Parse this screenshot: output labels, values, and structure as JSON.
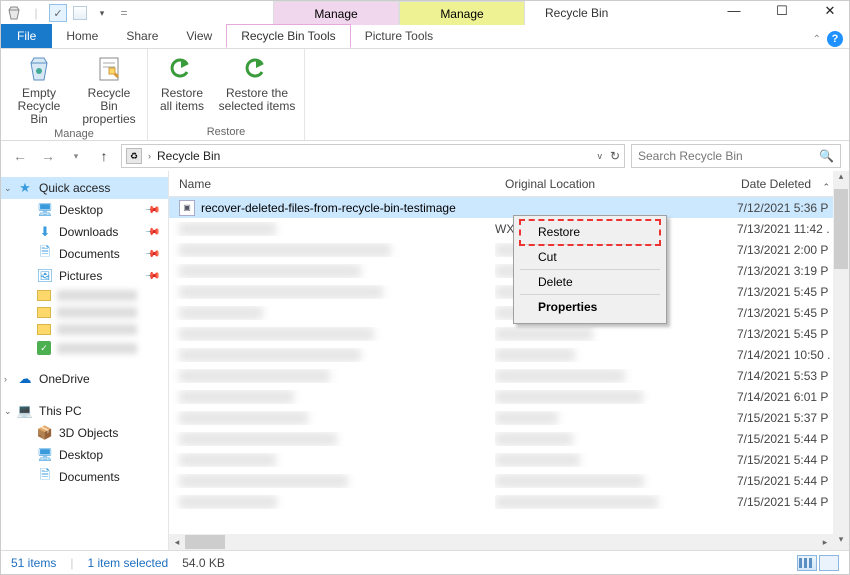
{
  "window": {
    "title": "Recycle Bin"
  },
  "qab": {
    "check": "✓"
  },
  "titleTabs": {
    "t1": {
      "manage": "Manage",
      "label": "Recycle Bin Tools"
    },
    "t2": {
      "manage": "Manage",
      "label": "Picture Tools"
    }
  },
  "tabs": {
    "file": "File",
    "home": "Home",
    "share": "Share",
    "view": "View",
    "rbt": "Recycle Bin Tools",
    "pt": "Picture Tools"
  },
  "ribbon": {
    "group1": {
      "label": "Manage",
      "btn1": "Empty\nRecycle Bin",
      "btn2": "Recycle Bin\nproperties"
    },
    "group2": {
      "label": "Restore",
      "btn1": "Restore\nall items",
      "btn2": "Restore the\nselected items"
    }
  },
  "address": {
    "text": "Recycle Bin"
  },
  "search": {
    "placeholder": "Search Recycle Bin"
  },
  "sidebar": {
    "quick": "Quick access",
    "desktop": "Desktop",
    "downloads": "Downloads",
    "documents": "Documents",
    "pictures": "Pictures",
    "onedrive": "OneDrive",
    "thispc": "This PC",
    "objects3d": "3D Objects",
    "desktop2": "Desktop",
    "documents2": "Documents"
  },
  "columns": {
    "name": "Name",
    "orig": "Original Location",
    "date": "Date Deleted"
  },
  "rows": [
    {
      "name": "recover-deleted-files-from-recycle-bin-testimage",
      "orig": "",
      "date": "7/12/2021 5:36 P"
    },
    {
      "name": "",
      "orig": "WXWork\\1...",
      "date": "7/13/2021 11:42 ."
    },
    {
      "name": "",
      "orig": "",
      "date": "7/13/2021 2:00 P"
    },
    {
      "name": "",
      "orig": "",
      "date": "7/13/2021 3:19 P"
    },
    {
      "name": "",
      "orig": "",
      "date": "7/13/2021 5:45 P"
    },
    {
      "name": "",
      "orig": "",
      "date": "7/13/2021 5:45 P"
    },
    {
      "name": "",
      "orig": "",
      "date": "7/13/2021 5:45 P"
    },
    {
      "name": "",
      "orig": "",
      "date": "7/14/2021 10:50 ."
    },
    {
      "name": "",
      "orig": "",
      "date": "7/14/2021 5:53 P"
    },
    {
      "name": "",
      "orig": "",
      "date": "7/14/2021 6:01 P"
    },
    {
      "name": "",
      "orig": "",
      "date": "7/15/2021 5:37 P"
    },
    {
      "name": "",
      "orig": "",
      "date": "7/15/2021 5:44 P"
    },
    {
      "name": "",
      "orig": "",
      "date": "7/15/2021 5:44 P"
    },
    {
      "name": "",
      "orig": "",
      "date": "7/15/2021 5:44 P"
    },
    {
      "name": "",
      "orig": "",
      "date": "7/15/2021 5:44 P"
    }
  ],
  "ctx": {
    "restore": "Restore",
    "cut": "Cut",
    "delete": "Delete",
    "properties": "Properties"
  },
  "status": {
    "count": "51 items",
    "sel": "1 item selected",
    "size": "54.0 KB"
  }
}
